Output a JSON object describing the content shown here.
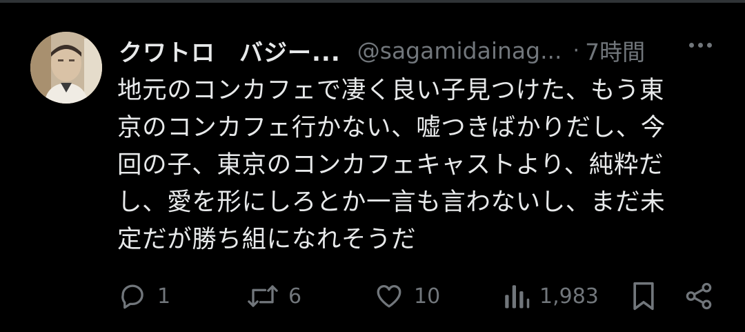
{
  "tweet": {
    "display_name": "クワトロ　バジー...",
    "handle": "@sagamidainag...",
    "separator": "·",
    "time": "7時間",
    "text": "地元のコンカフェで凄く良い子見つけた、もう東\n京のコンカフェ行かない、嘘つきばかりだし、今\n回の子、東京のコンカフェキャストより、純粋だ\nし、愛を形にしろとか一言も言わないし、まだ未\n定だが勝ち組になれそうだ"
  },
  "actions": {
    "reply_count": "1",
    "retweet_count": "6",
    "like_count": "10",
    "views_count": "1,983"
  },
  "icons": {
    "reply": "reply-icon",
    "retweet": "retweet-icon",
    "like": "heart-icon",
    "views": "views-icon",
    "bookmark": "bookmark-icon",
    "share": "share-icon",
    "more": "more-icon"
  },
  "colors": {
    "background": "#000000",
    "text_primary": "#e7e9ea",
    "text_secondary": "#71767b",
    "divider": "#2f3336"
  }
}
